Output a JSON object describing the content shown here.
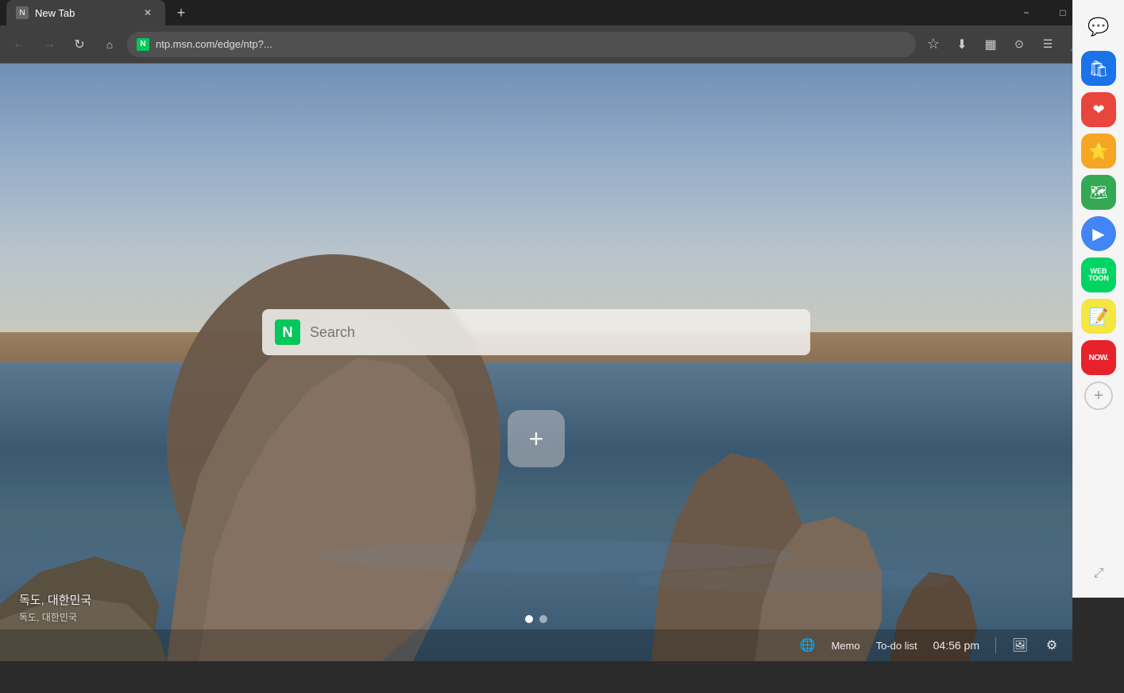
{
  "window": {
    "title": "New Tab",
    "minimize_label": "−",
    "maximize_label": "□",
    "close_label": "✕"
  },
  "tab": {
    "label": "New Tab",
    "new_tab_label": "+"
  },
  "nav": {
    "back_label": "←",
    "forward_label": "→",
    "refresh_label": "↻",
    "address": "ntp.msn.com/edge/ntp?...",
    "favicon_label": "N"
  },
  "search": {
    "placeholder": "Search",
    "logo_label": "N"
  },
  "photo_credit": {
    "main": "독도, 대한민국",
    "sub": "독도, 대한민국"
  },
  "pagination": {
    "dots": [
      true,
      false
    ]
  },
  "bottom_bar": {
    "memo_label": "Memo",
    "todo_label": "To-do list",
    "time": "04:56 pm",
    "add_shortcut_label": "+"
  },
  "sidebar": {
    "items": [
      {
        "name": "chat",
        "label": "💬",
        "bg": "transparent",
        "icon_unicode": "💬"
      },
      {
        "name": "shopping",
        "label": "🛍",
        "bg": "#1a73e8",
        "icon_unicode": "🛍"
      },
      {
        "name": "heart",
        "label": "❤",
        "bg": "#e8453c",
        "icon_unicode": "❤"
      },
      {
        "name": "star",
        "label": "⭐",
        "bg": "#f5a623",
        "icon_unicode": "⭐"
      },
      {
        "name": "map",
        "label": "🗺",
        "bg": "#34a853",
        "icon_unicode": "🗺"
      },
      {
        "name": "play",
        "label": "▶",
        "bg": "#4285f4",
        "icon_unicode": "▶"
      },
      {
        "name": "webtoon",
        "label": "W",
        "bg": "#00d564",
        "icon_unicode": "W"
      },
      {
        "name": "notes",
        "label": "📝",
        "bg": "#f5e642",
        "icon_unicode": "📝"
      },
      {
        "name": "now",
        "label": "NOW.",
        "bg": "#e8222a",
        "icon_unicode": "NOW."
      }
    ],
    "add_label": "+",
    "external_label": "⬡"
  }
}
